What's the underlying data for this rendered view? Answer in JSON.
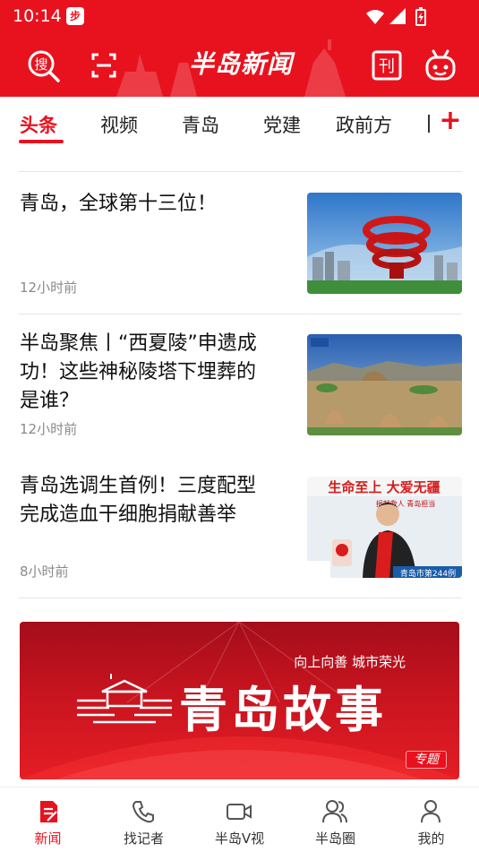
{
  "status_bar": {
    "time": "10:14",
    "app_badge": "步"
  },
  "header": {
    "logo_text": "半岛新闻"
  },
  "tabs": [
    {
      "label": "头条",
      "active": true
    },
    {
      "label": "视频",
      "active": false
    },
    {
      "label": "青岛",
      "active": false
    },
    {
      "label": "党建",
      "active": false
    },
    {
      "label": "政前方",
      "active": false
    }
  ],
  "tab_add": "+",
  "news": [
    {
      "title": "青岛，全球第十三位！",
      "time": "12小时前"
    },
    {
      "title": "半岛聚焦丨“西夏陵”申遗成功！这些神秘陵塔下埋葬的是谁？",
      "time": "12小时前"
    },
    {
      "title": "青岛选调生首例！三度配型完成造血干细胞捐献善举",
      "time": "8小时前"
    }
  ],
  "thumb3": {
    "banner_top": "生命至上 大爱无疆",
    "banner_sub": "捐献救人 青岛担当",
    "stat": "青岛市第244例"
  },
  "banner": {
    "subtitle": "向上向善 城市荣光",
    "title": "青岛故事",
    "tag": "专题"
  },
  "bottom_nav": [
    {
      "label": "新闻",
      "icon": "news-icon",
      "active": true
    },
    {
      "label": "找记者",
      "icon": "phone-icon",
      "active": false
    },
    {
      "label": "半岛V视",
      "icon": "video-icon",
      "active": false
    },
    {
      "label": "半岛圈",
      "icon": "people-icon",
      "active": false
    },
    {
      "label": "我的",
      "icon": "user-icon",
      "active": false
    }
  ],
  "colors": {
    "brand_red": "#e8121e"
  }
}
